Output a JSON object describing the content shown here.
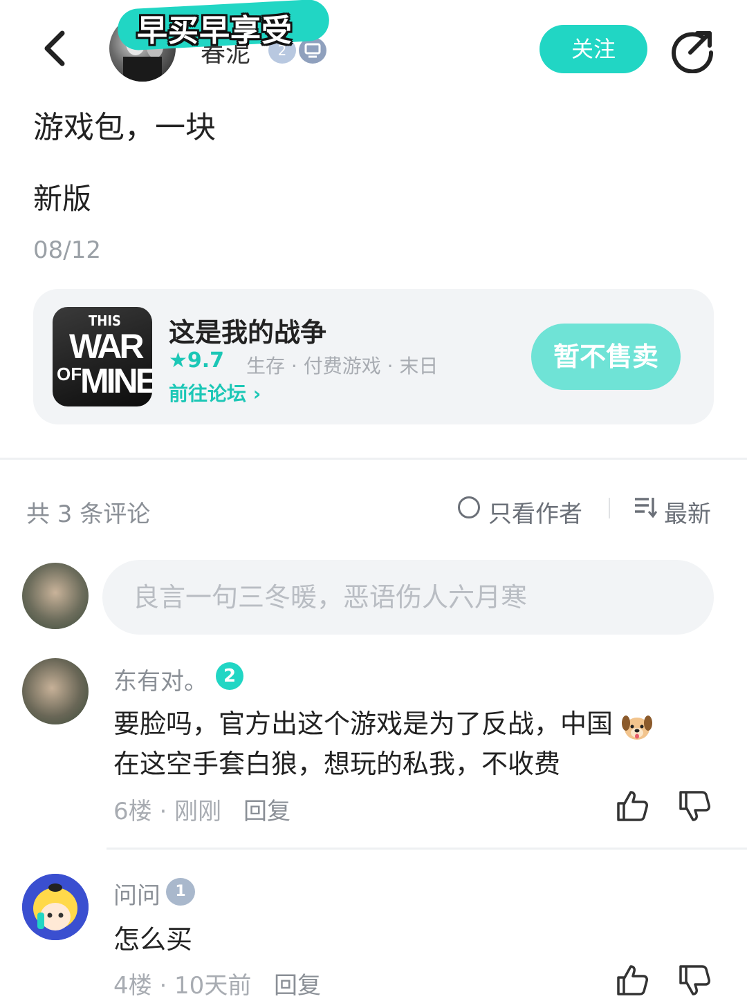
{
  "header": {
    "author_name": "春泥",
    "level_badge": "2",
    "follow_label": "关注",
    "sticker_text": "早买早享受"
  },
  "post": {
    "title": "游戏包，一块",
    "line2": "新版",
    "date": "08/12"
  },
  "game": {
    "name": "这是我的战争",
    "logo_line1": "THIS",
    "logo_line2": "WAR",
    "logo_line3": "OF",
    "logo_line4": "MINE",
    "score": "★9.7",
    "tags": "生存 · 付费游戏 · 末日",
    "forum_link": "前往论坛 ›",
    "action_label": "暂不售卖"
  },
  "comments_header": {
    "count_label": "共 3 条评论",
    "author_only_label": "只看作者",
    "sort_label": "最新"
  },
  "comment_input": {
    "placeholder": "良言一句三冬暖，恶语伤人六月寒"
  },
  "comments": [
    {
      "name": "东有对。",
      "level": "2",
      "text_line1": "要脸吗，官方出这个游戏是为了反战，中国",
      "text_line2": "在这空手套白狼，想玩的私我，不收费",
      "floor": "6楼 · 刚刚",
      "reply": "回复"
    },
    {
      "name": "问问",
      "level": "1",
      "text_line1": "怎么买",
      "floor": "4楼 · 10天前",
      "reply": "回复"
    }
  ],
  "colors": {
    "accent": "#21d6c4",
    "accent_light": "#6fe3d6",
    "card_bg": "#f2f4f6",
    "muted_text": "#8a8f96"
  },
  "icons": [
    "back-arrow-icon",
    "share-icon",
    "star-icon",
    "chevron-right-icon",
    "radio-icon",
    "sort-icon",
    "thumbs-up-icon",
    "thumbs-down-icon",
    "dog-emoji-icon"
  ]
}
